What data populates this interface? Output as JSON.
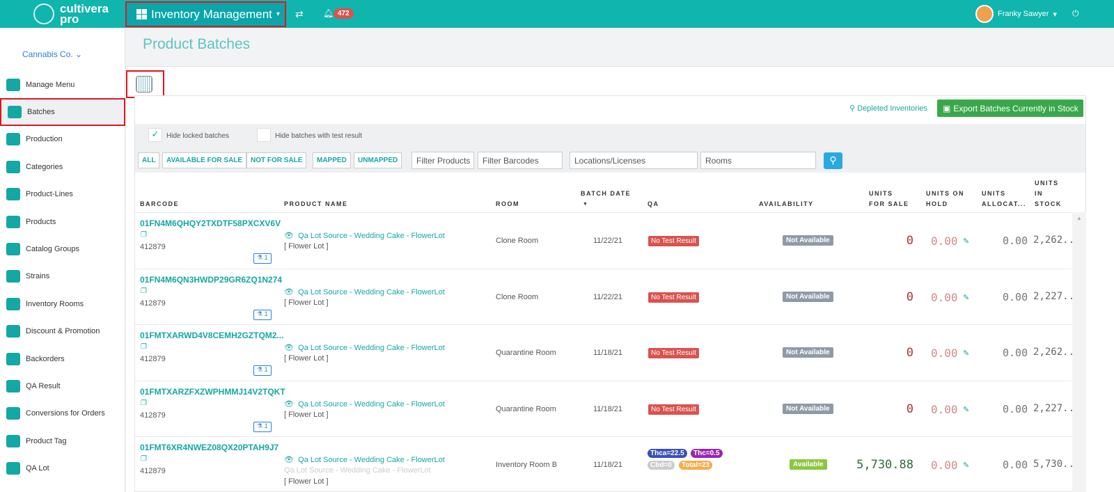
{
  "header": {
    "logo_line1": "cultivera",
    "logo_line2": "pro",
    "module": "Inventory Management",
    "notifications": "472",
    "user": "Franky Sawyer"
  },
  "sidebar": {
    "company": "Cannabis Co.",
    "items": [
      {
        "label": "Manage Menu"
      },
      {
        "label": "Batches"
      },
      {
        "label": "Production"
      },
      {
        "label": "Categories"
      },
      {
        "label": "Product-Lines"
      },
      {
        "label": "Products"
      },
      {
        "label": "Catalog Groups"
      },
      {
        "label": "Strains"
      },
      {
        "label": "Inventory Rooms"
      },
      {
        "label": "Discount & Promotion"
      },
      {
        "label": "Backorders"
      },
      {
        "label": "QA Result"
      },
      {
        "label": "Conversions for Orders"
      },
      {
        "label": "Product Tag"
      },
      {
        "label": "QA Lot"
      }
    ]
  },
  "page": {
    "title": "Product Batches",
    "depleted": "Depleted Inventories",
    "export": "Export Batches Currently in Stock"
  },
  "filters": {
    "hide_locked": "Hide locked batches",
    "hide_locked_checked": true,
    "hide_tested": "Hide batches with test result",
    "buttons": [
      "ALL",
      "AVAILABLE FOR SALE",
      "NOT FOR SALE",
      "MAPPED",
      "UNMAPPED"
    ],
    "filter_products": "Filter Products",
    "filter_barcodes": "Filter Barcodes",
    "locations": "Locations/Licenses",
    "rooms": "Rooms"
  },
  "table": {
    "headers": [
      "BARCODE",
      "PRODUCT NAME",
      "ROOM",
      "BATCH DATE",
      "QA",
      "AVAILABILITY",
      "UNITS FOR SALE",
      "UNITS ON HOLD",
      "UNITS ALLOCAT...",
      "UNITS IN STOCK"
    ],
    "sort_indicator": "▼",
    "rows": [
      {
        "barcode": "01FN4M6QHQY2TXDTF58PXCXV6V",
        "lot": "412879",
        "qa_count": "1",
        "product": "Qa Lot Source - Wedding Cake - FlowerLot",
        "type": "[ Flower Lot ]",
        "room": "Clone Room",
        "date": "11/22/21",
        "qa": "No Test Result",
        "availability": "Not Available",
        "for_sale": "0",
        "on_hold": "0.00",
        "allocated": "0.00",
        "in_stock": "2,262...."
      },
      {
        "barcode": "01FN4M6QN3HWDP29GR6ZQ1N274",
        "lot": "412879",
        "qa_count": "1",
        "product": "Qa Lot Source - Wedding Cake - FlowerLot",
        "type": "[ Flower Lot ]",
        "room": "Clone Room",
        "date": "11/22/21",
        "qa": "No Test Result",
        "availability": "Not Available",
        "for_sale": "0",
        "on_hold": "0.00",
        "allocated": "0.00",
        "in_stock": "2,227...."
      },
      {
        "barcode": "01FMTXARWD4V8CEMH2GZTQM2...",
        "lot": "412879",
        "qa_count": "1",
        "product": "Qa Lot Source - Wedding Cake - FlowerLot",
        "type": "[ Flower Lot ]",
        "room": "Quarantine Room",
        "date": "11/18/21",
        "qa": "No Test Result",
        "availability": "Not Available",
        "for_sale": "0",
        "on_hold": "0.00",
        "allocated": "0.00",
        "in_stock": "2,262...."
      },
      {
        "barcode": "01FMTXARZFXZWPHMMJ14V2TQKT",
        "lot": "412879",
        "qa_count": "1",
        "product": "Qa Lot Source - Wedding Cake - FlowerLot",
        "type": "[ Flower Lot ]",
        "room": "Quarantine Room",
        "date": "11/18/21",
        "qa": "No Test Result",
        "availability": "Not Available",
        "for_sale": "0",
        "on_hold": "0.00",
        "allocated": "0.00",
        "in_stock": "2,227...."
      },
      {
        "barcode": "01FMT6XR4NWEZ08QX20PTAH9J7",
        "lot": "412879",
        "product": "Qa Lot Source - Wedding Cake - FlowerLot",
        "product_sub": "Qa Lot Source - Wedding Cake - FlowerLot",
        "type": "[ Flower Lot ]",
        "room": "Inventory Room B",
        "date": "11/18/21",
        "qa_pills": [
          "Thca=22.5",
          "Thc=0.5",
          "Cbd=0",
          "Total=23"
        ],
        "availability": "Available",
        "for_sale": "5,730.88",
        "on_hold": "0.00",
        "allocated": "0.00",
        "in_stock": "5,730...."
      }
    ]
  },
  "colors": {
    "brand": "#10b5ad",
    "danger": "#d9534f",
    "success": "#3aa84a"
  }
}
